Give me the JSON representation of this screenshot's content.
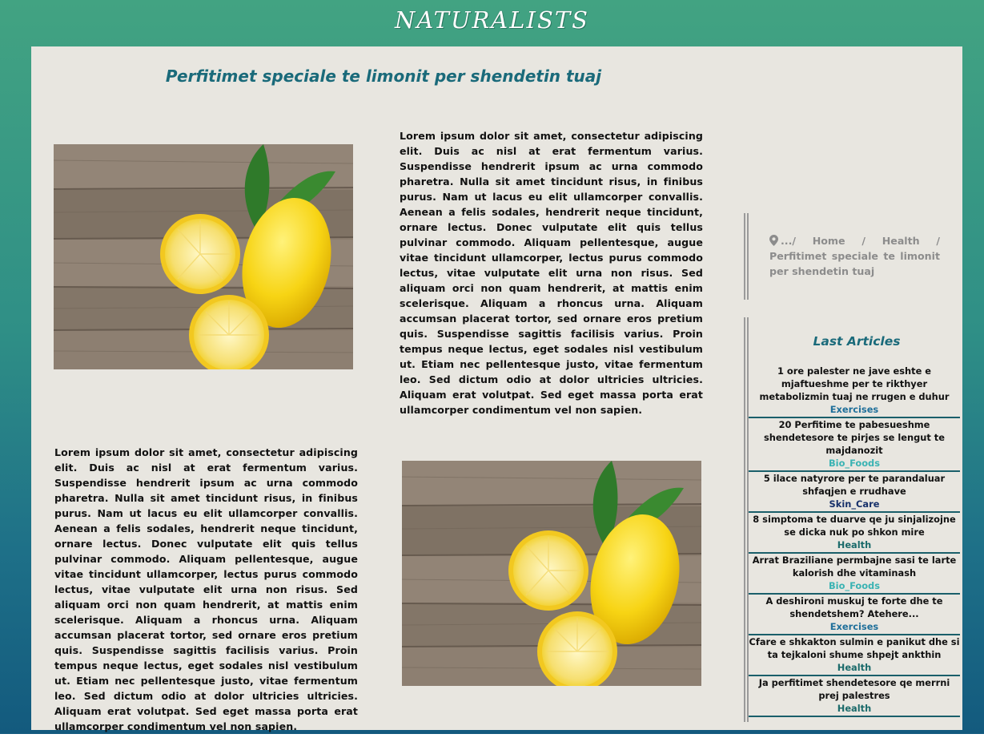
{
  "brand": "NATURALISTS",
  "article": {
    "title": "Perfitimet speciale te limonit per shendetin tuaj",
    "paragraph_1": "Lorem ipsum dolor sit amet, consectetur adipiscing elit. Duis ac nisl at erat fermentum varius. Suspendisse hendrerit ipsum ac urna commodo pharetra. Nulla sit amet tincidunt risus, in finibus purus. Nam ut lacus eu elit ullamcorper convallis. Aenean a felis sodales, hendrerit neque tincidunt, ornare lectus. Donec vulputate elit quis tellus pulvinar commodo. Aliquam pellentesque, augue vitae tincidunt ullamcorper, lectus purus commodo lectus, vitae vulputate elit urna non risus. Sed aliquam orci non quam hendrerit, at mattis enim scelerisque. Aliquam a rhoncus urna. Aliquam accumsan placerat tortor, sed ornare eros pretium quis. Suspendisse sagittis facilisis varius. Proin tempus neque lectus, eget sodales nisl vestibulum ut. Etiam nec pellentesque justo, vitae fermentum leo. Sed dictum odio at dolor ultricies ultricies. Aliquam erat volutpat. Sed eget massa porta erat ullamcorper condimentum vel non sapien.",
    "paragraph_2": "Lorem ipsum dolor sit amet, consectetur adipiscing elit. Duis ac nisl at erat fermentum varius. Suspendisse hendrerit ipsum ac urna commodo pharetra. Nulla sit amet tincidunt risus, in finibus purus. Nam ut lacus eu elit ullamcorper convallis. Aenean a felis sodales, hendrerit neque tincidunt, ornare lectus. Donec vulputate elit quis tellus pulvinar commodo. Aliquam pellentesque, augue vitae tincidunt ullamcorper, lectus purus commodo lectus, vitae vulputate elit urna non risus. Sed aliquam orci non quam hendrerit, at mattis enim scelerisque. Aliquam a rhoncus urna. Aliquam accumsan placerat tortor, sed ornare eros pretium quis. Suspendisse sagittis facilisis varius. Proin tempus neque lectus, eget sodales nisl vestibulum ut. Etiam nec pellentesque justo, vitae fermentum leo. Sed dictum odio at dolor ultricies ultricies. Aliquam erat volutpat. Sed eget massa porta erat ullamcorper condimentum vel non sapien."
  },
  "breadcrumb": {
    "icon": "map-marker-icon",
    "text": ".../ Home / Health / Perfitimet speciale te limonit per shendetin tuaj"
  },
  "last_articles": {
    "heading": "Last Articles",
    "items": [
      {
        "title": "1 ore palester ne jave eshte e mjaftueshme per te rikthyer metabolizmin tuaj ne rrugen e duhur",
        "category": "Exercises",
        "category_color": "#1f6f9a"
      },
      {
        "title": "20 Perfitime te pabesueshme shendetesore te pirjes se lengut te majdanozit",
        "category": "Bio_Foods",
        "category_color": "#3ab3b3"
      },
      {
        "title": "5 ilace natyrore per te parandaluar shfaqjen e rrudhave",
        "category": "Skin_Care",
        "category_color": "#16306a"
      },
      {
        "title": "8 simptoma te duarve qe ju sinjalizojne se dicka nuk po shkon mire",
        "category": "Health",
        "category_color": "#1a6a6a"
      },
      {
        "title": "Arrat Braziliane permbajne sasi te larte kalorish dhe vitaminash",
        "category": "Bio_Foods",
        "category_color": "#3ab3b3"
      },
      {
        "title": "A deshironi muskuj te forte dhe te shendetshem? Atehere...",
        "category": "Exercises",
        "category_color": "#1f6f9a"
      },
      {
        "title": "Cfare e shkakton sulmin e panikut dhe si ta tejkaloni shume shpejt ankthin",
        "category": "Health",
        "category_color": "#1a6a6a"
      },
      {
        "title": "Ja perfitimet shendetesore qe merrni prej palestres",
        "category": "Health",
        "category_color": "#1a6a6a"
      }
    ]
  }
}
